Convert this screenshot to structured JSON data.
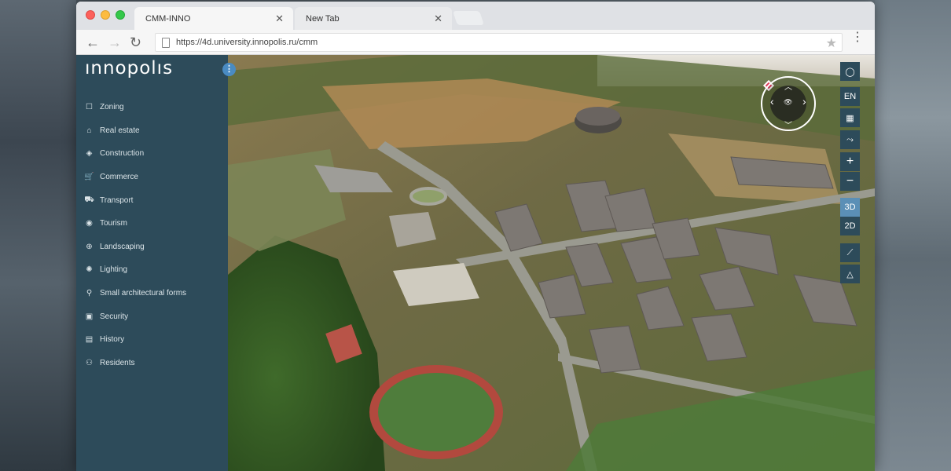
{
  "browser": {
    "tabs": [
      {
        "title": "CMM-INNO",
        "close": "✕"
      },
      {
        "title": "New Tab",
        "close": "✕"
      }
    ],
    "url": "https://4d.university.innopolis.ru/cmm",
    "back_icon": "←",
    "forward_icon": "→",
    "reload_icon": "↻",
    "star_icon": "★",
    "menu_icon": "⋮"
  },
  "sidebar": {
    "logo": "INNOPOLIS",
    "collapse_icon": "⋮",
    "items": [
      {
        "label": "Zoning",
        "icon": "☐"
      },
      {
        "label": "Real estate",
        "icon": "⌂"
      },
      {
        "label": "Construction",
        "icon": "◈"
      },
      {
        "label": "Commerce",
        "icon": "🛒"
      },
      {
        "label": "Transport",
        "icon": "⛟"
      },
      {
        "label": "Tourism",
        "icon": "◉"
      },
      {
        "label": "Landscaping",
        "icon": "⊕"
      },
      {
        "label": "Lighting",
        "icon": "✺"
      },
      {
        "label": "Small architectural forms",
        "icon": "⚲"
      },
      {
        "label": "Security",
        "icon": "▣"
      },
      {
        "label": "History",
        "icon": "▤"
      },
      {
        "label": "Residents",
        "icon": "⚇"
      }
    ]
  },
  "map_controls": {
    "user_icon": "◯",
    "language": "EN",
    "map_icon": "▦",
    "route_icon": "⤳",
    "zoom_in": "+",
    "zoom_out": "−",
    "mode_3d": "3D",
    "mode_2d": "2D",
    "ruler_icon": "⟋",
    "polygon_icon": "△"
  },
  "compass": {
    "up": "︿",
    "down": "﹀",
    "left": "‹",
    "right": "›",
    "center": "👁"
  },
  "colors": {
    "sidebar_bg": "#2d4b5a",
    "active_mode": "#5b8fb6",
    "accent": "#4a8bc2"
  }
}
